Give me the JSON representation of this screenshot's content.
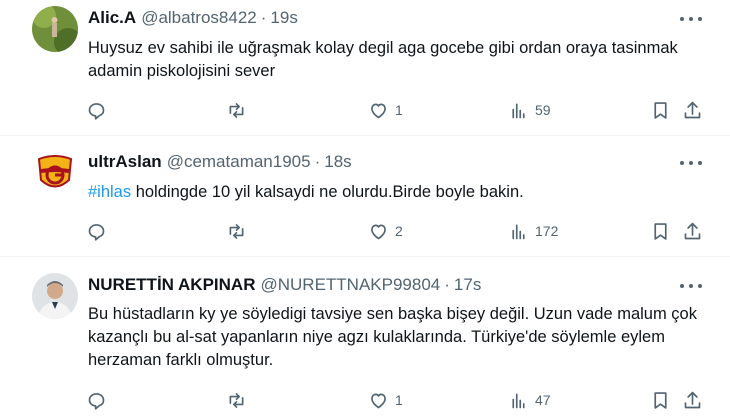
{
  "tweets": [
    {
      "name": "Alic.A",
      "handle": "@albatros8422",
      "time": "19s",
      "text": "Huysuz ev sahibi ile uğraşmak kolay degil aga gocebe gibi ordan oraya tasinmak adamin piskolojisini sever",
      "hashtag": "",
      "replies": "",
      "retweets": "",
      "likes": "1",
      "views": "59"
    },
    {
      "name": "ultrAslan",
      "handle": "@cemataman1905",
      "time": "18s",
      "hashtag": "#ihlas",
      "text": " holdingde 10 yil kalsaydi ne olurdu.Birde boyle bakin.",
      "replies": "",
      "retweets": "",
      "likes": "2",
      "views": "172"
    },
    {
      "name": "NURETTİN AKPINAR",
      "handle": "@NURETTNAKP99804",
      "time": "17s",
      "text": "Bu hüstadların ky ye söyledigi tavsiye sen başka bişey değil. Uzun vade malum çok kazançlı bu al-sat yapanların niye agzı kulaklarında. Türkiye'de söylemle eylem herzaman farklı olmuştur.",
      "hashtag": "",
      "replies": "",
      "retweets": "",
      "likes": "1",
      "views": "47"
    }
  ],
  "separator": "·",
  "colors": {
    "accent": "#1d9bf0",
    "muted": "#536471",
    "text": "#0f1419",
    "divider": "#eff3f4"
  }
}
